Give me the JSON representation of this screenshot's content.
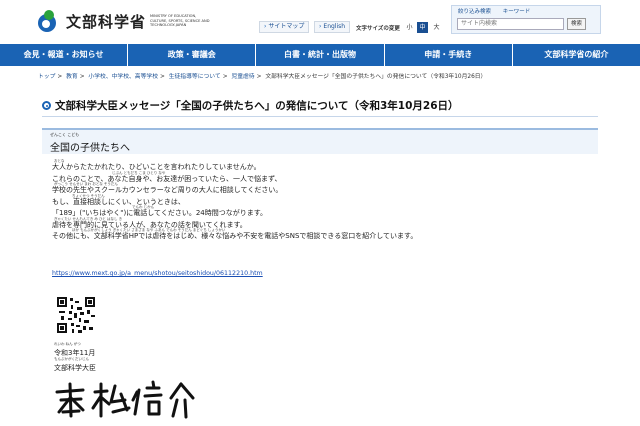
{
  "header": {
    "logo_title": "文部科学省",
    "logo_sub": "MINISTRY OF EDUCATION, CULTURE, SPORTS, SCIENCE AND TECHNOLOGY-JAPAN",
    "sitemap": "サイトマップ",
    "english": "English",
    "font_size_label": "文字サイズの変更",
    "font_small": "小",
    "font_mid": "中",
    "font_large": "大",
    "search_tab_1": "絞り込み検索",
    "search_tab_2": "キーワード",
    "search_placeholder": "サイト内検索",
    "search_button": "検索"
  },
  "nav": [
    "会見・報道・お知らせ",
    "政策・審議会",
    "白書・統計・出版物",
    "申請・手続き",
    "文部科学省の紹介"
  ],
  "breadcrumb": [
    "トップ",
    "教育",
    "小学校、中学校、高等学校",
    "生徒指導等について",
    "児童虐待",
    "文部科学大臣メッセージ「全国の子供たちへ」の発信について（令和3年10月26日）"
  ],
  "page_title": "文部科学大臣メッセージ「全国の子供たちへ」の発信について（令和3年10月26日）",
  "section": {
    "ruby": "ぜんこく こども",
    "heading": "全国の子供たちへ"
  },
  "message": [
    {
      "ruby": "おとな",
      "text": "大人からたたかれたり、ひどいことを言われたりしていませんか。"
    },
    {
      "ruby": "じぶん ともだち こま ひとり なや",
      "text": "これらのことで、あなた自身や、お友達が困っていたら、一人で悩まず、"
    },
    {
      "ruby": "がっこう せんせい まわ おとな そうだん",
      "text": "学校の先生やスクールカウンセラーなど周りの大人に相談してください。"
    },
    {
      "ruby": "ちょくせつ そうだん",
      "text": "もし、直接相談しにくい、というときは、"
    },
    {
      "ruby": "でんわ じかん",
      "text": "「189」(\"いちはやく\")に電話してください。24時間つながります。"
    },
    {
      "ruby": "ぎゃくたい せんもんてき み ひと はなし き",
      "text": "虐待を専門的に見ている人が、あなたの話を聞いてくれます。"
    },
    {
      "ruby": "ほか もんぶかがくしょう ぎゃくたい さまざま なや ふあん でんわ そうだん まどぐち しょうかい",
      "text": "その他にも、文部科学省HPでは虐待をはじめ、様々な悩みや不安を電話やSNSで相談できる窓口を紹介しています。"
    }
  ],
  "link": "https://www.mext.go.jp/a_menu/shotou/seitoshidou/06112210.htm",
  "date_ruby": "れいわ ねん がつ",
  "date": "令和3年11月",
  "minister_ruby": "もんぶかがくだいじん",
  "minister": "文部科学大臣"
}
